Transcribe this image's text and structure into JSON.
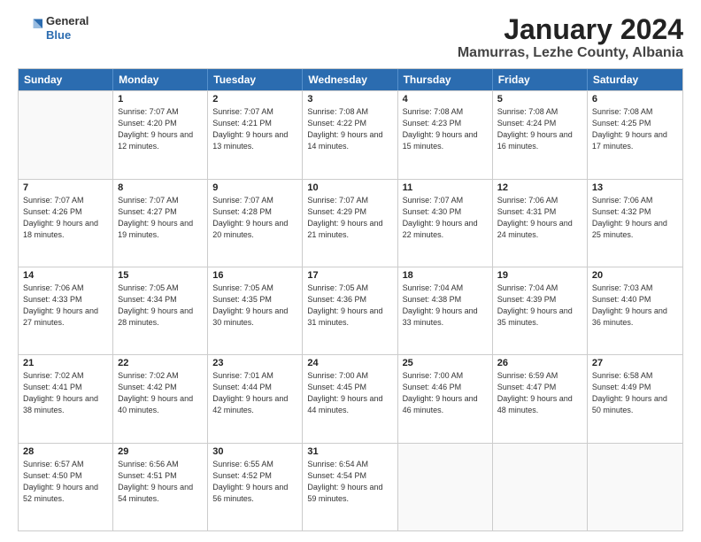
{
  "header": {
    "logo_line1": "General",
    "logo_line2": "Blue",
    "title": "January 2024",
    "location": "Mamurras, Lezhe County, Albania"
  },
  "weekdays": [
    "Sunday",
    "Monday",
    "Tuesday",
    "Wednesday",
    "Thursday",
    "Friday",
    "Saturday"
  ],
  "weeks": [
    [
      {
        "day": "",
        "empty": true
      },
      {
        "day": "1",
        "sunrise": "7:07 AM",
        "sunset": "4:20 PM",
        "daylight": "9 hours and 12 minutes."
      },
      {
        "day": "2",
        "sunrise": "7:07 AM",
        "sunset": "4:21 PM",
        "daylight": "9 hours and 13 minutes."
      },
      {
        "day": "3",
        "sunrise": "7:08 AM",
        "sunset": "4:22 PM",
        "daylight": "9 hours and 14 minutes."
      },
      {
        "day": "4",
        "sunrise": "7:08 AM",
        "sunset": "4:23 PM",
        "daylight": "9 hours and 15 minutes."
      },
      {
        "day": "5",
        "sunrise": "7:08 AM",
        "sunset": "4:24 PM",
        "daylight": "9 hours and 16 minutes."
      },
      {
        "day": "6",
        "sunrise": "7:08 AM",
        "sunset": "4:25 PM",
        "daylight": "9 hours and 17 minutes."
      }
    ],
    [
      {
        "day": "7",
        "sunrise": "7:07 AM",
        "sunset": "4:26 PM",
        "daylight": "9 hours and 18 minutes."
      },
      {
        "day": "8",
        "sunrise": "7:07 AM",
        "sunset": "4:27 PM",
        "daylight": "9 hours and 19 minutes."
      },
      {
        "day": "9",
        "sunrise": "7:07 AM",
        "sunset": "4:28 PM",
        "daylight": "9 hours and 20 minutes."
      },
      {
        "day": "10",
        "sunrise": "7:07 AM",
        "sunset": "4:29 PM",
        "daylight": "9 hours and 21 minutes."
      },
      {
        "day": "11",
        "sunrise": "7:07 AM",
        "sunset": "4:30 PM",
        "daylight": "9 hours and 22 minutes."
      },
      {
        "day": "12",
        "sunrise": "7:06 AM",
        "sunset": "4:31 PM",
        "daylight": "9 hours and 24 minutes."
      },
      {
        "day": "13",
        "sunrise": "7:06 AM",
        "sunset": "4:32 PM",
        "daylight": "9 hours and 25 minutes."
      }
    ],
    [
      {
        "day": "14",
        "sunrise": "7:06 AM",
        "sunset": "4:33 PM",
        "daylight": "9 hours and 27 minutes."
      },
      {
        "day": "15",
        "sunrise": "7:05 AM",
        "sunset": "4:34 PM",
        "daylight": "9 hours and 28 minutes."
      },
      {
        "day": "16",
        "sunrise": "7:05 AM",
        "sunset": "4:35 PM",
        "daylight": "9 hours and 30 minutes."
      },
      {
        "day": "17",
        "sunrise": "7:05 AM",
        "sunset": "4:36 PM",
        "daylight": "9 hours and 31 minutes."
      },
      {
        "day": "18",
        "sunrise": "7:04 AM",
        "sunset": "4:38 PM",
        "daylight": "9 hours and 33 minutes."
      },
      {
        "day": "19",
        "sunrise": "7:04 AM",
        "sunset": "4:39 PM",
        "daylight": "9 hours and 35 minutes."
      },
      {
        "day": "20",
        "sunrise": "7:03 AM",
        "sunset": "4:40 PM",
        "daylight": "9 hours and 36 minutes."
      }
    ],
    [
      {
        "day": "21",
        "sunrise": "7:02 AM",
        "sunset": "4:41 PM",
        "daylight": "9 hours and 38 minutes."
      },
      {
        "day": "22",
        "sunrise": "7:02 AM",
        "sunset": "4:42 PM",
        "daylight": "9 hours and 40 minutes."
      },
      {
        "day": "23",
        "sunrise": "7:01 AM",
        "sunset": "4:44 PM",
        "daylight": "9 hours and 42 minutes."
      },
      {
        "day": "24",
        "sunrise": "7:00 AM",
        "sunset": "4:45 PM",
        "daylight": "9 hours and 44 minutes."
      },
      {
        "day": "25",
        "sunrise": "7:00 AM",
        "sunset": "4:46 PM",
        "daylight": "9 hours and 46 minutes."
      },
      {
        "day": "26",
        "sunrise": "6:59 AM",
        "sunset": "4:47 PM",
        "daylight": "9 hours and 48 minutes."
      },
      {
        "day": "27",
        "sunrise": "6:58 AM",
        "sunset": "4:49 PM",
        "daylight": "9 hours and 50 minutes."
      }
    ],
    [
      {
        "day": "28",
        "sunrise": "6:57 AM",
        "sunset": "4:50 PM",
        "daylight": "9 hours and 52 minutes."
      },
      {
        "day": "29",
        "sunrise": "6:56 AM",
        "sunset": "4:51 PM",
        "daylight": "9 hours and 54 minutes."
      },
      {
        "day": "30",
        "sunrise": "6:55 AM",
        "sunset": "4:52 PM",
        "daylight": "9 hours and 56 minutes."
      },
      {
        "day": "31",
        "sunrise": "6:54 AM",
        "sunset": "4:54 PM",
        "daylight": "9 hours and 59 minutes."
      },
      {
        "day": "",
        "empty": true
      },
      {
        "day": "",
        "empty": true
      },
      {
        "day": "",
        "empty": true
      }
    ]
  ]
}
